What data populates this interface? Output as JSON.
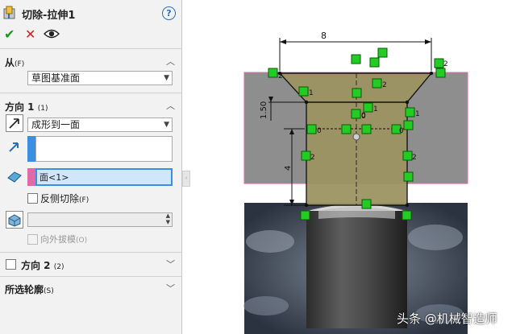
{
  "feature": {
    "title": "切除-拉伸1",
    "help": "?"
  },
  "actions": {
    "ok": "✔",
    "cancel": "✕",
    "preview": "👁"
  },
  "from": {
    "header": "从",
    "header_key": "(F)",
    "value": "草图基准面"
  },
  "direction1": {
    "header": "方向 1",
    "header_key": "(1)",
    "end_condition": "成形到一面",
    "face_selection": "面<1>",
    "flip_side_label": "反侧切除",
    "flip_side_key": "(F)",
    "draft_outward_label": "向外拔模",
    "draft_outward_key": "(O)",
    "draft_value": ""
  },
  "direction2": {
    "header": "方向 2",
    "header_key": "(2)"
  },
  "selected_contours": {
    "header": "所选轮廓",
    "header_key": "(S)"
  },
  "sketch": {
    "dimensions": {
      "top_width": "8",
      "chamfer_depth": "1.50",
      "slot_height": "4"
    },
    "relation_labels": [
      "2",
      "0",
      "2",
      "1",
      "0",
      "1",
      "0",
      "1",
      "0",
      "2",
      "2",
      "2"
    ]
  },
  "watermark": "头条 @机械智造师",
  "colors": {
    "accent_blue": "#2a6ebb",
    "selection_pink": "#e06aa8",
    "ok_green": "#1a9a1a",
    "cancel_red": "#cc1f1f",
    "sketch_fill": "#9c9462",
    "body_gray": "#8e8e8e",
    "constraint_green": "#22cc22"
  }
}
